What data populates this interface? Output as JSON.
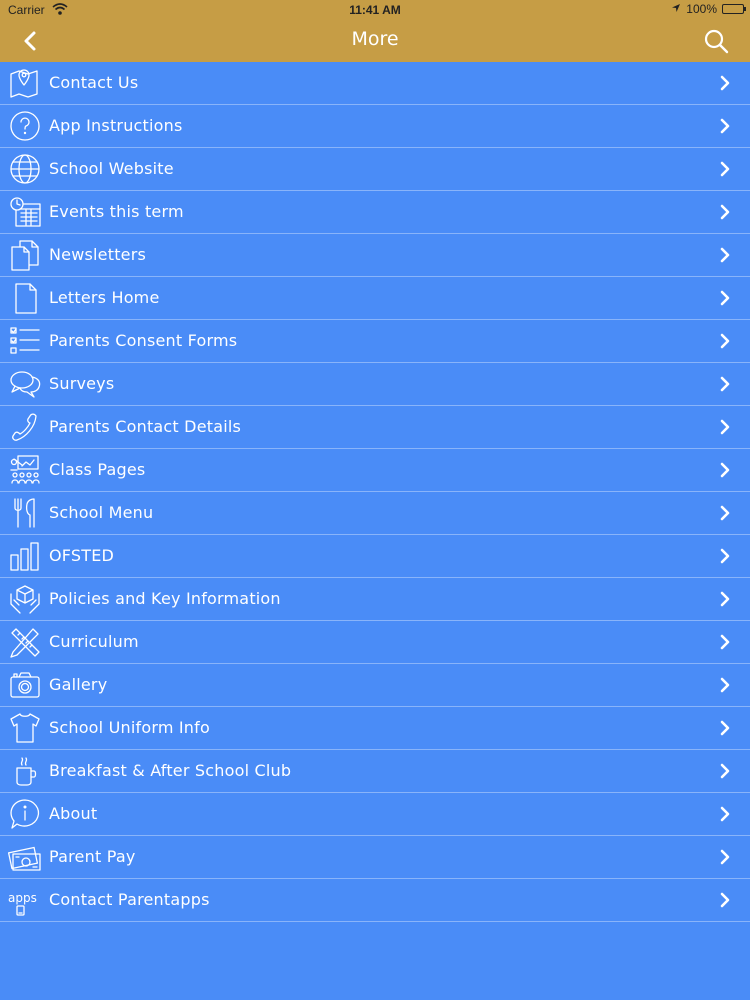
{
  "status_bar": {
    "carrier": "Carrier",
    "time": "11:41 AM",
    "battery": "100%"
  },
  "nav": {
    "title": "More"
  },
  "colors": {
    "accent": "#c69d45",
    "background": "#4a8cf7",
    "text": "#ffffff"
  },
  "menu": [
    {
      "label": "Contact Us",
      "icon": "map-pin-icon"
    },
    {
      "label": "App Instructions",
      "icon": "question-icon"
    },
    {
      "label": "School Website",
      "icon": "globe-icon"
    },
    {
      "label": "Events this term",
      "icon": "calendar-clock-icon"
    },
    {
      "label": "Newsletters",
      "icon": "documents-icon"
    },
    {
      "label": "Letters Home",
      "icon": "document-icon"
    },
    {
      "label": "Parents Consent Forms",
      "icon": "checklist-icon"
    },
    {
      "label": "Surveys",
      "icon": "chat-bubbles-icon"
    },
    {
      "label": "Parents Contact Details",
      "icon": "phone-icon"
    },
    {
      "label": "Class Pages",
      "icon": "classroom-icon"
    },
    {
      "label": "School Menu",
      "icon": "cutlery-icon"
    },
    {
      "label": "OFSTED",
      "icon": "bar-chart-icon"
    },
    {
      "label": "Policies and Key Information",
      "icon": "hands-cube-icon"
    },
    {
      "label": "Curriculum",
      "icon": "pencil-ruler-icon"
    },
    {
      "label": "Gallery",
      "icon": "camera-icon"
    },
    {
      "label": "School Uniform Info",
      "icon": "tshirt-icon"
    },
    {
      "label": "Breakfast & After School Club",
      "icon": "coffee-cup-icon"
    },
    {
      "label": "About",
      "icon": "info-bubble-icon"
    },
    {
      "label": "Parent Pay",
      "icon": "money-icon"
    },
    {
      "label": "Contact Parentapps",
      "icon": "apps-icon"
    }
  ]
}
